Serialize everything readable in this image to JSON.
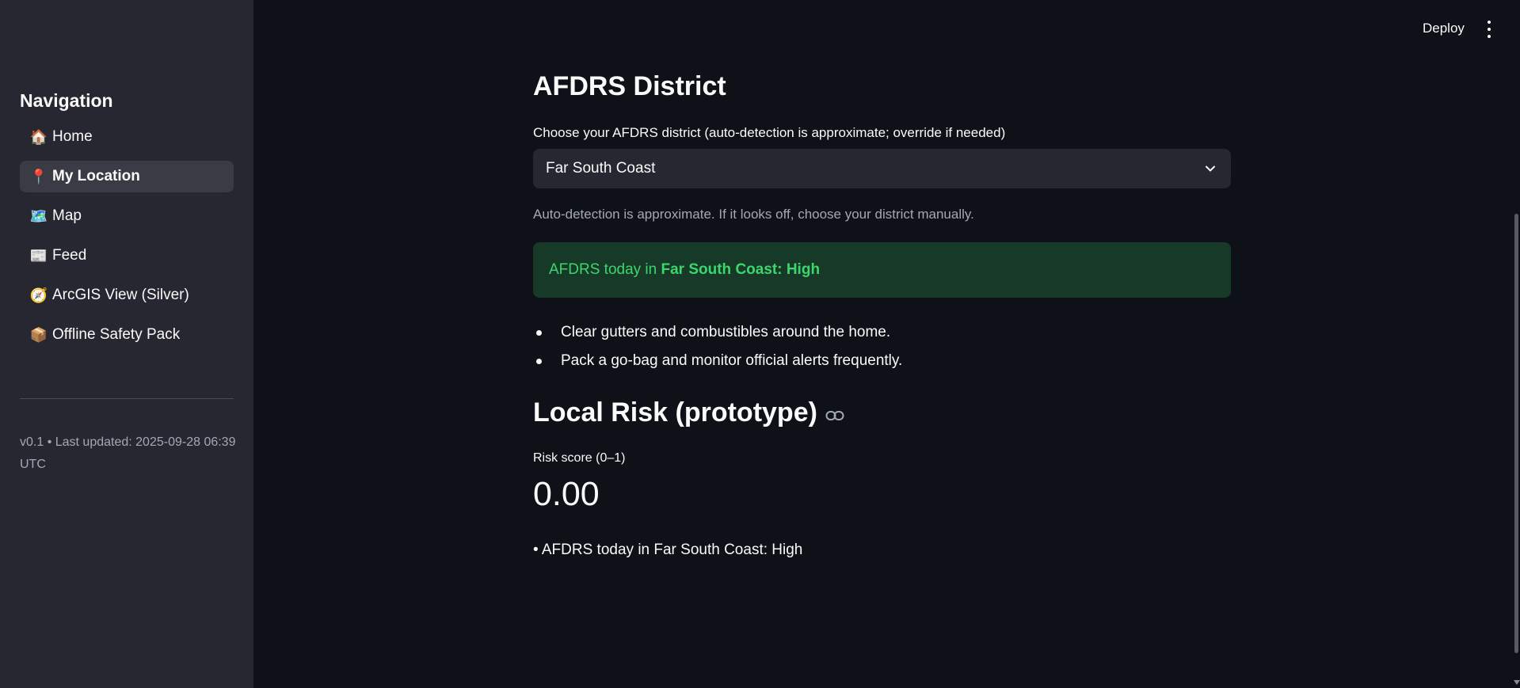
{
  "header": {
    "deploy_label": "Deploy"
  },
  "sidebar": {
    "title": "Navigation",
    "items": [
      {
        "emoji": "🏠",
        "label": "Home",
        "active": false
      },
      {
        "emoji": "📍",
        "label": "My Location",
        "active": true
      },
      {
        "emoji": "🗺️",
        "label": "Map",
        "active": false
      },
      {
        "emoji": "📰",
        "label": "Feed",
        "active": false
      },
      {
        "emoji": "🧭",
        "label": "ArcGIS View (Silver)",
        "active": false
      },
      {
        "emoji": "📦",
        "label": "Offline Safety Pack",
        "active": false
      }
    ],
    "footer": "v0.1 • Last updated: 2025-09-28 06:39 UTC"
  },
  "main": {
    "district_heading": "AFDRS District",
    "select_label": "Choose your AFDRS district (auto-detection is approximate; override if needed)",
    "selected_district": "Far South Coast",
    "caption": "Auto-detection is approximate. If it looks off, choose your district manually.",
    "alert": {
      "prefix": "AFDRS today in ",
      "emphasis": "Far South Coast: High",
      "color": "#3dd56d",
      "background": "#173928"
    },
    "advice": [
      "Clear gutters and combustibles around the home.",
      "Pack a go-bag and monitor official alerts frequently."
    ],
    "risk_heading": "Local Risk (prototype)",
    "metric_label": "Risk score (0–1)",
    "metric_value": "0.00",
    "risk_note": "• AFDRS today in Far South Coast: High"
  },
  "colors": {
    "background": "#0e1117",
    "sidebar": "#262730",
    "active_item": "#3a3b45",
    "muted_text": "#a3a8b4"
  }
}
